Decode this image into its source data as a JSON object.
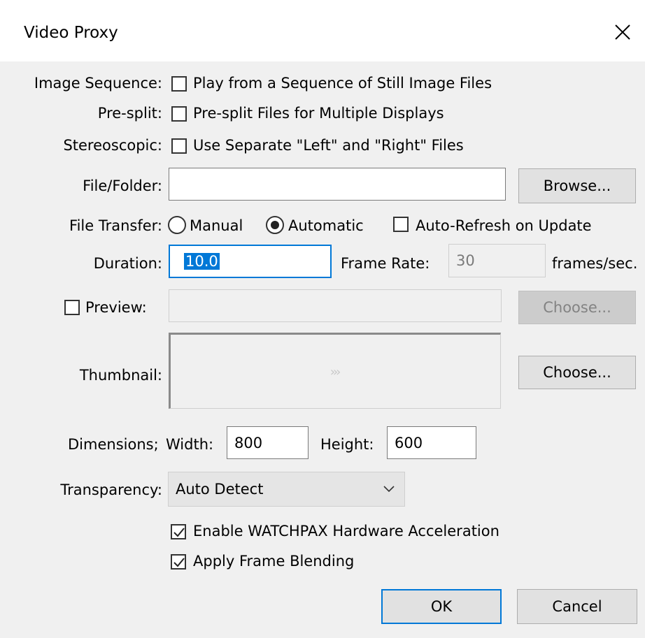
{
  "window": {
    "title": "Video Proxy"
  },
  "image_sequence": {
    "label": "Image Sequence:",
    "option": "Play from a Sequence of Still Image Files",
    "checked": false
  },
  "pre_split": {
    "label": "Pre-split:",
    "option": "Pre-split Files for Multiple Displays",
    "checked": false
  },
  "stereoscopic": {
    "label": "Stereoscopic:",
    "option": "Use Separate \"Left\" and \"Right\" Files",
    "checked": false
  },
  "file_folder": {
    "label": "File/Folder:",
    "value": "",
    "browse_label": "Browse..."
  },
  "file_transfer": {
    "label": "File Transfer:",
    "manual_label": "Manual",
    "automatic_label": "Automatic",
    "selected": "Automatic",
    "auto_refresh_label": "Auto-Refresh on Update",
    "auto_refresh_checked": false
  },
  "duration": {
    "label": "Duration:",
    "value": "10.0"
  },
  "frame_rate": {
    "label": "Frame Rate:",
    "value": "30",
    "unit": "frames/sec."
  },
  "preview": {
    "label": "Preview:",
    "checked": false,
    "value": "",
    "choose_label": "Choose..."
  },
  "thumbnail": {
    "label": "Thumbnail:",
    "glyph": "›››",
    "choose_label": "Choose..."
  },
  "dimensions": {
    "label": "Dimensions;",
    "width_label": "Width:",
    "width_value": "800",
    "height_label": "Height:",
    "height_value": "600"
  },
  "transparency": {
    "label": "Transparency:",
    "value": "Auto Detect"
  },
  "hw_accel": {
    "label": "Enable WATCHPAX Hardware Acceleration",
    "checked": true
  },
  "frame_blending": {
    "label": "Apply Frame Blending",
    "checked": true
  },
  "buttons": {
    "ok": "OK",
    "cancel": "Cancel"
  }
}
